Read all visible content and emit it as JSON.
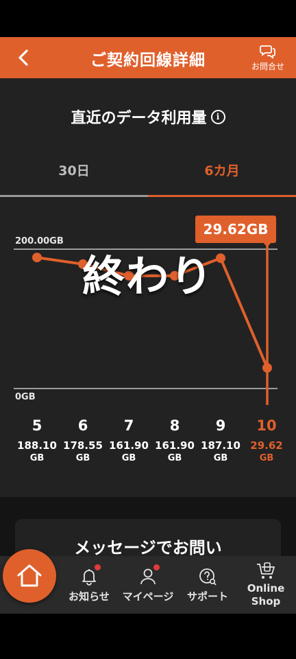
{
  "header": {
    "title": "ご契約回線詳細",
    "contact_label": "お問合せ"
  },
  "usage": {
    "section_title": "直近のデータ利用量",
    "info_icon_glyph": "i",
    "tabs": [
      {
        "label": "30日",
        "active": false
      },
      {
        "label": "6カ月",
        "active": true
      }
    ],
    "tooltip_value": "29.62GB",
    "overlay_text": "終わり"
  },
  "chart_data": {
    "type": "line",
    "x": [
      "5",
      "6",
      "7",
      "8",
      "9",
      "10"
    ],
    "series": [
      {
        "values": [
          188.1,
          178.55,
          161.9,
          161.9,
          187.1,
          29.62
        ]
      }
    ],
    "ylim": [
      0,
      200
    ],
    "ytick_labels": [
      "200.00GB",
      "0GB"
    ],
    "value_labels": [
      "188.10",
      "178.55",
      "161.90",
      "161.90",
      "187.10",
      "29.62"
    ],
    "unit_label": "GB",
    "highlight_index": 5,
    "color": "#e0602c"
  },
  "message_card": {
    "title": "メッセージでお問い"
  },
  "bottom_nav": {
    "items": [
      {
        "label": "お知らせ",
        "icon": "bell-icon",
        "badge": true
      },
      {
        "label": "マイページ",
        "icon": "person-icon",
        "badge": true
      },
      {
        "label": "サポート",
        "icon": "support-icon",
        "badge": false
      },
      {
        "label": "Online Shop",
        "icon": "shop-icon",
        "badge": false
      }
    ]
  },
  "colors": {
    "accent": "#e0602c",
    "background": "#222222",
    "badge": "#e23b3b"
  }
}
